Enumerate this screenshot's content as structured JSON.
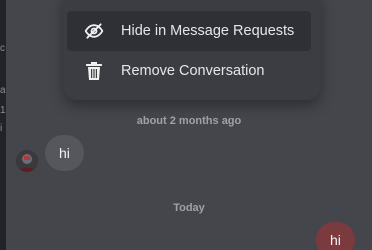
{
  "menu": {
    "items": [
      {
        "label": "Hide in Message Requests",
        "icon": "eye-off-icon",
        "active": true
      },
      {
        "label": "Remove Conversation",
        "icon": "trash-icon",
        "active": false
      }
    ]
  },
  "messages": {
    "timestamp_1": "about 2 months ago",
    "incoming": {
      "text": "hi"
    },
    "timestamp_2": "Today",
    "outgoing": {
      "text": "hi"
    }
  },
  "colors": {
    "background": "#45464c",
    "menu": "#3c3d43",
    "menu_hover": "#2f3035",
    "incoming_bubble": "#56575d",
    "outgoing_bubble": "#7a3a3e"
  }
}
